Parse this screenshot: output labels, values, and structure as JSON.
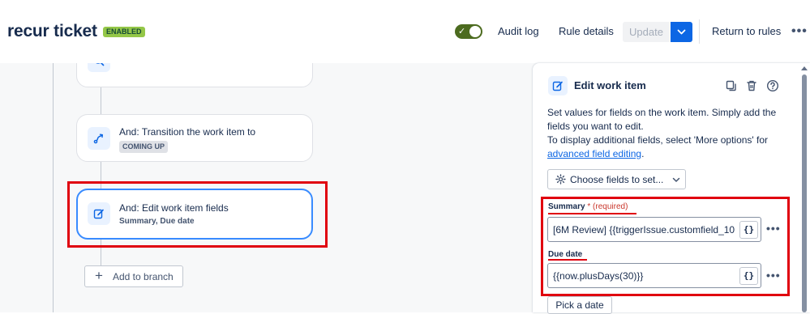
{
  "header": {
    "title": "recur ticket",
    "status_badge": "ENABLED",
    "rule_enabled": true,
    "audit_log": "Audit log",
    "rule_details": "Rule details",
    "update": "Update",
    "return_to_rules": "Return to rules",
    "more": "•••"
  },
  "flow": {
    "transition_card": {
      "title": "And: Transition the work item to",
      "status": "COMING UP"
    },
    "edit_card": {
      "title": "And: Edit work item fields",
      "subtitle": "Summary, Due date"
    },
    "add_branch": "Add to branch"
  },
  "panel": {
    "title": "Edit work item",
    "desc_line1": "Set values for fields on the work item. Simply add the fields you want to edit.",
    "desc_line2": "To display additional fields, select 'More options' for",
    "desc_link": "advanced field editing",
    "desc_end": ".",
    "choose_fields": "Choose fields to set...",
    "summary_label": "Summary",
    "summary_star": "*",
    "summary_required": "(required)",
    "summary_value": "[6M Review] {{triggerIssue.customfield_10",
    "due_date_label": "Due date",
    "due_date_value": "{{now.plusDays(30)}}",
    "brace_button": "{}",
    "field_more": "•••",
    "pick_date": "Pick a date"
  },
  "colors": {
    "accent": "#0c66e4",
    "enabled_badge": "#94c748",
    "toggle_on": "#4c6b1f",
    "highlight_red": "#e0000f"
  }
}
